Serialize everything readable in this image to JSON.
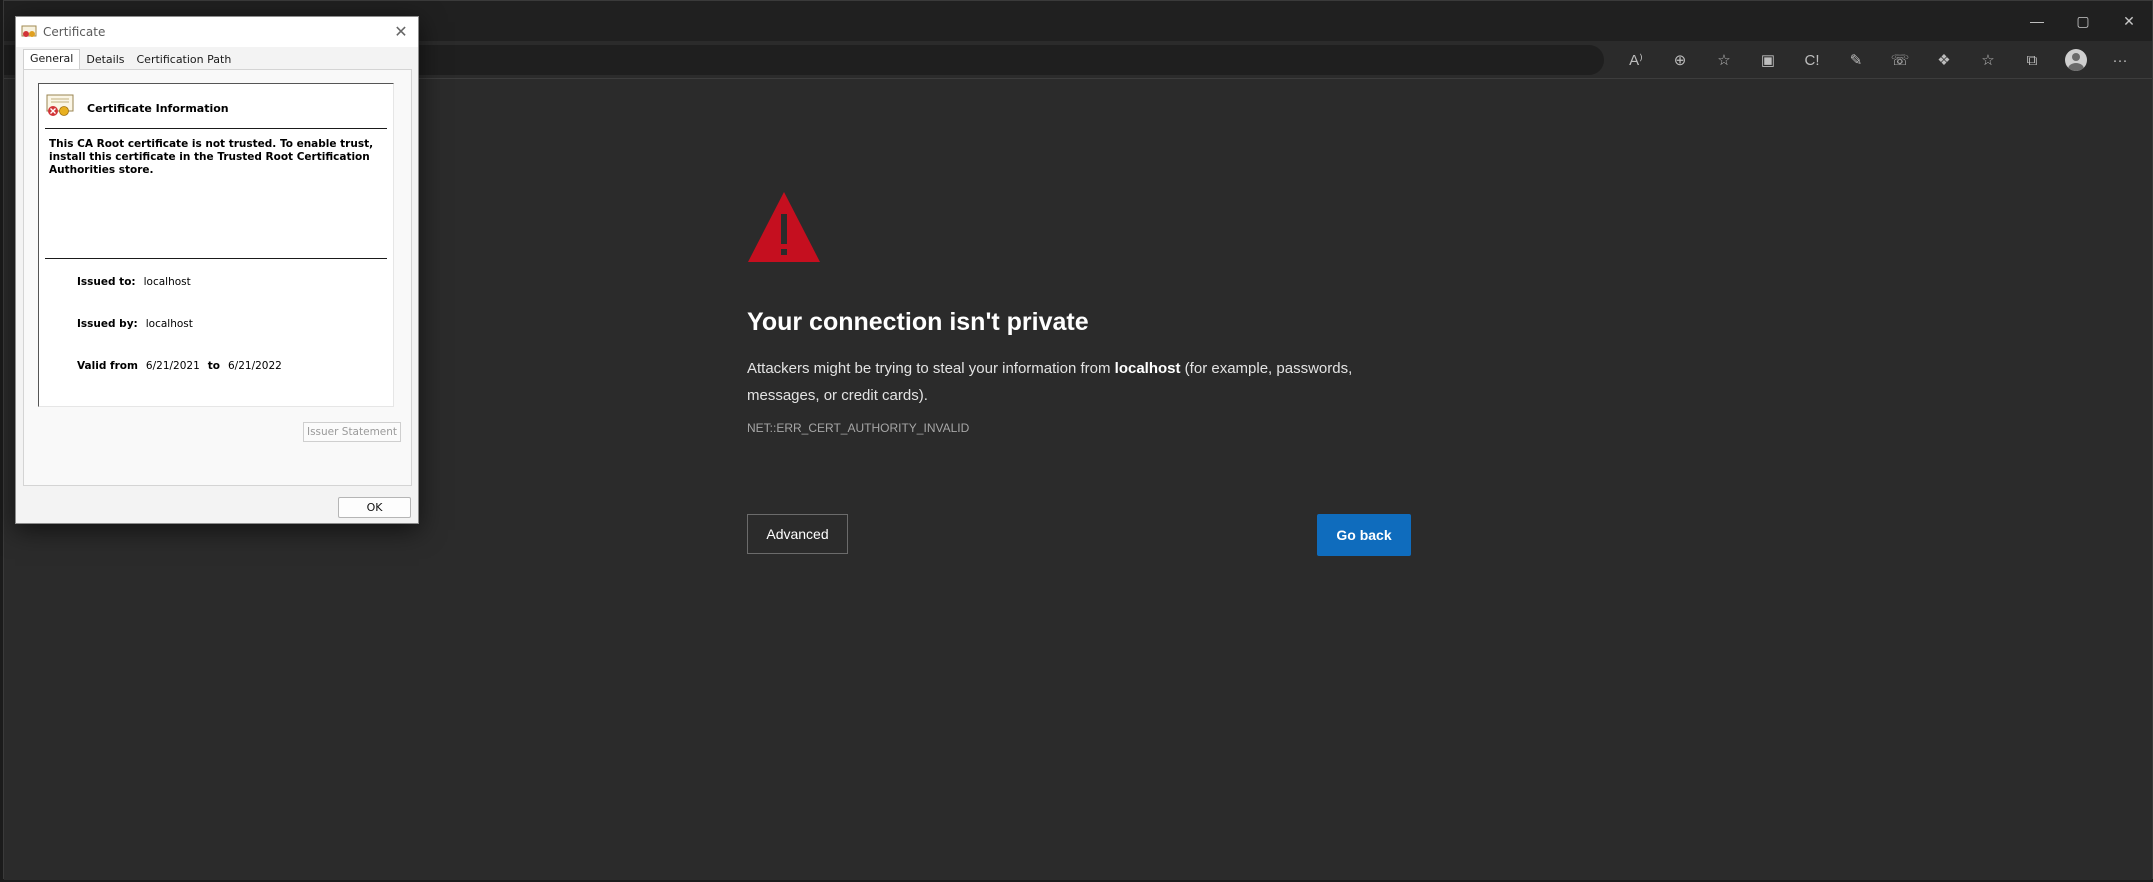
{
  "browser": {
    "window_controls": [
      "minimize",
      "maximize",
      "close"
    ],
    "toolbar_icons": [
      {
        "name": "read-aloud-icon",
        "glyph": "A⁾"
      },
      {
        "name": "zoom-icon",
        "glyph": "⊕"
      },
      {
        "name": "add-favorite-icon",
        "glyph": "☆"
      },
      {
        "name": "extension-icon-1",
        "glyph": "▣"
      },
      {
        "name": "extension-icon-2",
        "glyph": "C!"
      },
      {
        "name": "extension-icon-3",
        "glyph": "✎"
      },
      {
        "name": "extension-icon-4",
        "glyph": "☏"
      },
      {
        "name": "extensions-icon",
        "glyph": "❖"
      },
      {
        "name": "favorites-icon",
        "glyph": "☆"
      },
      {
        "name": "collections-icon",
        "glyph": "⧉"
      },
      {
        "name": "profile-icon",
        "glyph": ""
      },
      {
        "name": "more-icon",
        "glyph": "···"
      }
    ]
  },
  "error_page": {
    "title": "Your connection isn't private",
    "desc_before": "Attackers might be trying to steal your information from ",
    "desc_host": "localhost",
    "desc_after": " (for example, passwords, messages, or credit cards).",
    "code": "NET::ERR_CERT_AUTHORITY_INVALID",
    "advanced_label": "Advanced",
    "goback_label": "Go back",
    "accent_color": "#0f6cbd",
    "warning_color": "#c50f1f"
  },
  "dialog": {
    "title": "Certificate",
    "tabs": [
      "General",
      "Details",
      "Certification Path"
    ],
    "info_heading": "Certificate Information",
    "info_text": "This CA Root certificate is not trusted. To enable trust, install this certificate in the Trusted Root Certification Authorities store.",
    "issued_to_label": "Issued to:",
    "issued_to": "localhost",
    "issued_by_label": "Issued by:",
    "issued_by": "localhost",
    "valid_from_label": "Valid from",
    "valid_from": "6/21/2021",
    "valid_to_label": "to",
    "valid_to": "6/21/2022",
    "issuer_statement_label": "Issuer Statement",
    "ok_label": "OK"
  }
}
